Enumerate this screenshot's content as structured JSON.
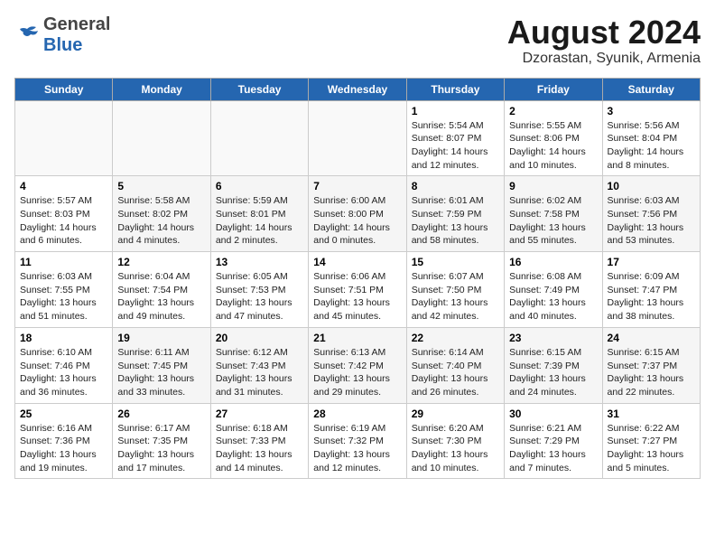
{
  "header": {
    "logo_general": "General",
    "logo_blue": "Blue",
    "title": "August 2024",
    "subtitle": "Dzorastan, Syunik, Armenia"
  },
  "weekdays": [
    "Sunday",
    "Monday",
    "Tuesday",
    "Wednesday",
    "Thursday",
    "Friday",
    "Saturday"
  ],
  "weeks": [
    [
      {
        "day": "",
        "info": ""
      },
      {
        "day": "",
        "info": ""
      },
      {
        "day": "",
        "info": ""
      },
      {
        "day": "",
        "info": ""
      },
      {
        "day": "1",
        "info": "Sunrise: 5:54 AM\nSunset: 8:07 PM\nDaylight: 14 hours\nand 12 minutes."
      },
      {
        "day": "2",
        "info": "Sunrise: 5:55 AM\nSunset: 8:06 PM\nDaylight: 14 hours\nand 10 minutes."
      },
      {
        "day": "3",
        "info": "Sunrise: 5:56 AM\nSunset: 8:04 PM\nDaylight: 14 hours\nand 8 minutes."
      }
    ],
    [
      {
        "day": "4",
        "info": "Sunrise: 5:57 AM\nSunset: 8:03 PM\nDaylight: 14 hours\nand 6 minutes."
      },
      {
        "day": "5",
        "info": "Sunrise: 5:58 AM\nSunset: 8:02 PM\nDaylight: 14 hours\nand 4 minutes."
      },
      {
        "day": "6",
        "info": "Sunrise: 5:59 AM\nSunset: 8:01 PM\nDaylight: 14 hours\nand 2 minutes."
      },
      {
        "day": "7",
        "info": "Sunrise: 6:00 AM\nSunset: 8:00 PM\nDaylight: 14 hours\nand 0 minutes."
      },
      {
        "day": "8",
        "info": "Sunrise: 6:01 AM\nSunset: 7:59 PM\nDaylight: 13 hours\nand 58 minutes."
      },
      {
        "day": "9",
        "info": "Sunrise: 6:02 AM\nSunset: 7:58 PM\nDaylight: 13 hours\nand 55 minutes."
      },
      {
        "day": "10",
        "info": "Sunrise: 6:03 AM\nSunset: 7:56 PM\nDaylight: 13 hours\nand 53 minutes."
      }
    ],
    [
      {
        "day": "11",
        "info": "Sunrise: 6:03 AM\nSunset: 7:55 PM\nDaylight: 13 hours\nand 51 minutes."
      },
      {
        "day": "12",
        "info": "Sunrise: 6:04 AM\nSunset: 7:54 PM\nDaylight: 13 hours\nand 49 minutes."
      },
      {
        "day": "13",
        "info": "Sunrise: 6:05 AM\nSunset: 7:53 PM\nDaylight: 13 hours\nand 47 minutes."
      },
      {
        "day": "14",
        "info": "Sunrise: 6:06 AM\nSunset: 7:51 PM\nDaylight: 13 hours\nand 45 minutes."
      },
      {
        "day": "15",
        "info": "Sunrise: 6:07 AM\nSunset: 7:50 PM\nDaylight: 13 hours\nand 42 minutes."
      },
      {
        "day": "16",
        "info": "Sunrise: 6:08 AM\nSunset: 7:49 PM\nDaylight: 13 hours\nand 40 minutes."
      },
      {
        "day": "17",
        "info": "Sunrise: 6:09 AM\nSunset: 7:47 PM\nDaylight: 13 hours\nand 38 minutes."
      }
    ],
    [
      {
        "day": "18",
        "info": "Sunrise: 6:10 AM\nSunset: 7:46 PM\nDaylight: 13 hours\nand 36 minutes."
      },
      {
        "day": "19",
        "info": "Sunrise: 6:11 AM\nSunset: 7:45 PM\nDaylight: 13 hours\nand 33 minutes."
      },
      {
        "day": "20",
        "info": "Sunrise: 6:12 AM\nSunset: 7:43 PM\nDaylight: 13 hours\nand 31 minutes."
      },
      {
        "day": "21",
        "info": "Sunrise: 6:13 AM\nSunset: 7:42 PM\nDaylight: 13 hours\nand 29 minutes."
      },
      {
        "day": "22",
        "info": "Sunrise: 6:14 AM\nSunset: 7:40 PM\nDaylight: 13 hours\nand 26 minutes."
      },
      {
        "day": "23",
        "info": "Sunrise: 6:15 AM\nSunset: 7:39 PM\nDaylight: 13 hours\nand 24 minutes."
      },
      {
        "day": "24",
        "info": "Sunrise: 6:15 AM\nSunset: 7:37 PM\nDaylight: 13 hours\nand 22 minutes."
      }
    ],
    [
      {
        "day": "25",
        "info": "Sunrise: 6:16 AM\nSunset: 7:36 PM\nDaylight: 13 hours\nand 19 minutes."
      },
      {
        "day": "26",
        "info": "Sunrise: 6:17 AM\nSunset: 7:35 PM\nDaylight: 13 hours\nand 17 minutes."
      },
      {
        "day": "27",
        "info": "Sunrise: 6:18 AM\nSunset: 7:33 PM\nDaylight: 13 hours\nand 14 minutes."
      },
      {
        "day": "28",
        "info": "Sunrise: 6:19 AM\nSunset: 7:32 PM\nDaylight: 13 hours\nand 12 minutes."
      },
      {
        "day": "29",
        "info": "Sunrise: 6:20 AM\nSunset: 7:30 PM\nDaylight: 13 hours\nand 10 minutes."
      },
      {
        "day": "30",
        "info": "Sunrise: 6:21 AM\nSunset: 7:29 PM\nDaylight: 13 hours\nand 7 minutes."
      },
      {
        "day": "31",
        "info": "Sunrise: 6:22 AM\nSunset: 7:27 PM\nDaylight: 13 hours\nand 5 minutes."
      }
    ]
  ]
}
